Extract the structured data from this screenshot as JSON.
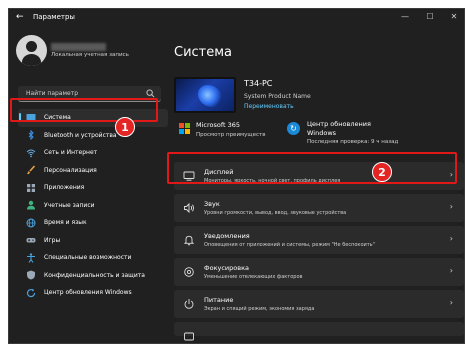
{
  "window": {
    "title": "Параметры",
    "back_glyph": "←",
    "minimize_glyph": "—",
    "maximize_glyph": "☐",
    "close_glyph": "✕"
  },
  "profile": {
    "account_type": "Локальная учетная запись"
  },
  "search": {
    "placeholder": "Найти параметр"
  },
  "nav": {
    "items": [
      {
        "label": "Система",
        "icon": "monitor-icon",
        "color": "#4aa3df"
      },
      {
        "label": "Bluetooth и устройства",
        "icon": "bluetooth-icon",
        "color": "#3b8ee0"
      },
      {
        "label": "Сеть и Интернет",
        "icon": "network-icon",
        "color": "#6ab0e8"
      },
      {
        "label": "Персонализация",
        "icon": "brush-icon",
        "color": "#e8a04a"
      },
      {
        "label": "Приложения",
        "icon": "apps-icon",
        "color": "#9aa8b8"
      },
      {
        "label": "Учетные записи",
        "icon": "person-icon",
        "color": "#3fb27f"
      },
      {
        "label": "Время и язык",
        "icon": "globe-icon",
        "color": "#4aa3df"
      },
      {
        "label": "Игры",
        "icon": "gamepad-icon",
        "color": "#9aa8b8"
      },
      {
        "label": "Специальные возможности",
        "icon": "accessibility-icon",
        "color": "#4aa3df"
      },
      {
        "label": "Конфиденциальность и защита",
        "icon": "shield-icon",
        "color": "#9aa8b8"
      },
      {
        "label": "Центр обновления Windows",
        "icon": "update-icon",
        "color": "#4aa3df"
      }
    ]
  },
  "main": {
    "heading": "Система",
    "device": {
      "name": "T34-PC",
      "model": "System Product Name",
      "rename_link": "Переименовать"
    },
    "ms365": {
      "title": "Microsoft 365",
      "subtitle": "Просмотр преимуществ"
    },
    "update": {
      "title": "Центр обновления Windows",
      "subtitle": "Последняя проверка: 9 ч назад"
    },
    "cards": [
      {
        "title": "Дисплей",
        "subtitle": "Мониторы, яркость, ночной свет, профиль дисплея",
        "icon": "display-icon"
      },
      {
        "title": "Звук",
        "subtitle": "Уровни громкости, вывод, ввод, звуковые устройства",
        "icon": "speaker-icon"
      },
      {
        "title": "Уведомления",
        "subtitle": "Оповещения от приложений и системы, режим \"Не беспокоить\"",
        "icon": "bell-icon"
      },
      {
        "title": "Фокусировка",
        "subtitle": "Уменьшение отвлекающих факторов",
        "icon": "focus-icon"
      },
      {
        "title": "Питание",
        "subtitle": "Экран и спящий режим, экономия заряда",
        "icon": "power-icon"
      },
      {
        "title": "",
        "subtitle": "",
        "icon": "storage-icon"
      }
    ],
    "chevron_glyph": "›"
  },
  "annotations": {
    "step1": "1",
    "step2": "2",
    "highlight_color": "#e01818"
  }
}
